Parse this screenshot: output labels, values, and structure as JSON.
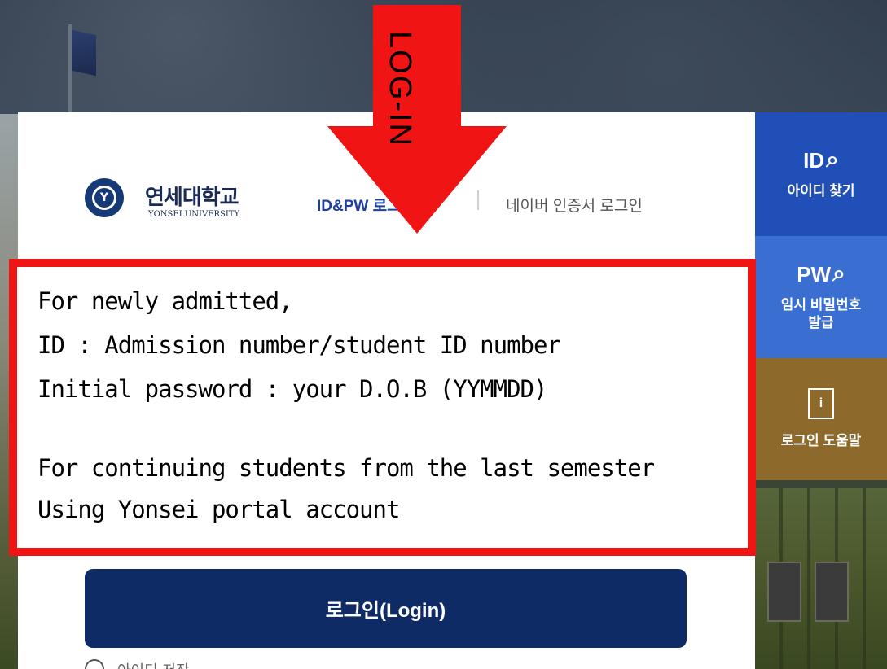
{
  "university": {
    "name_kr": "연세대학교",
    "name_en": "YONSEI UNIVERSITY"
  },
  "tabs": {
    "idpw": "ID&PW 로그인",
    "naver": "네이버 인증서 로그인"
  },
  "side": {
    "find_id": {
      "icon": "ID",
      "label": "아이디 찾기"
    },
    "temp_pw": {
      "icon": "PW",
      "label_line1": "임시 비밀번호",
      "label_line2": "발급"
    },
    "help": {
      "icon": "i",
      "label": "로그인 도움말"
    }
  },
  "login_button": "로그인(Login)",
  "remember": "아이디 저장",
  "annotation": {
    "arrow_label": "LOG-IN",
    "lines": [
      "For newly admitted,",
      "ID : Admission number/student ID number",
      "Initial password : your D.O.B (YYMMDD)",
      "",
      "For continuing students from the last semester",
      "Using Yonsei portal account"
    ]
  },
  "colors": {
    "primary": "#0f2b66",
    "find_id_bg": "#2050b7",
    "temp_pw_bg": "#3a6fd1",
    "help_bg": "#8d6a2b",
    "annotation_red": "#f01414"
  }
}
